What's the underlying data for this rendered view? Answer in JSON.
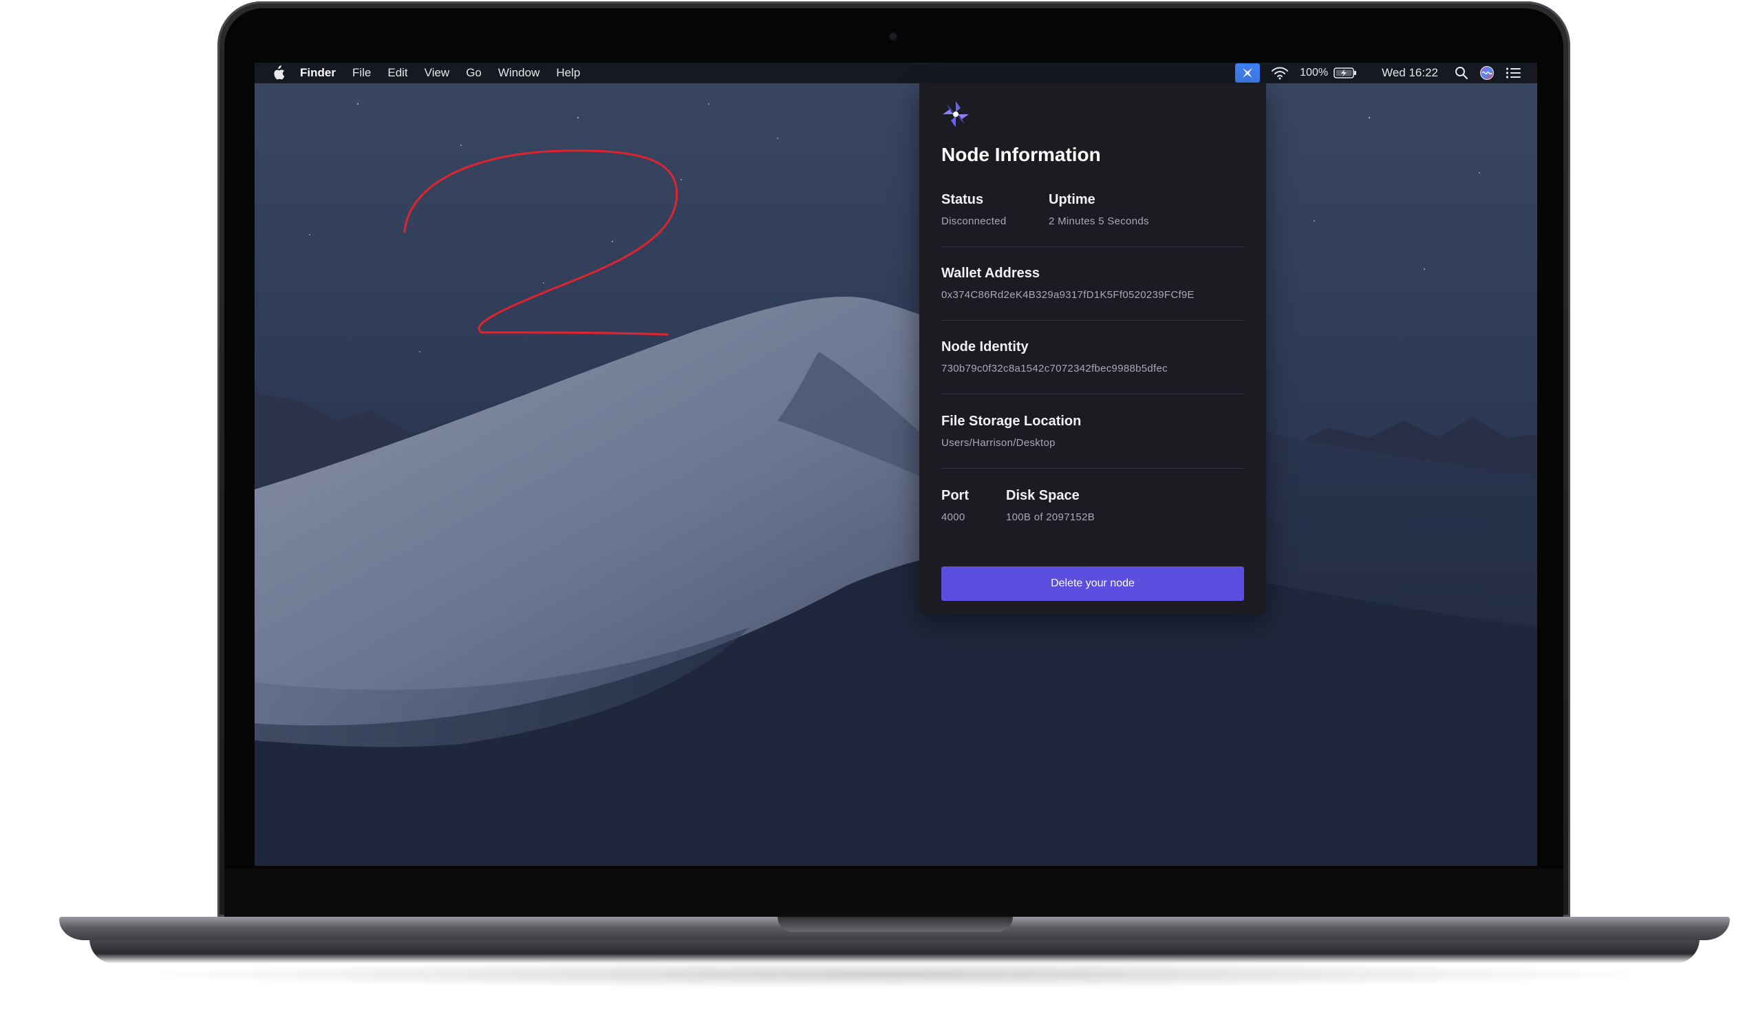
{
  "menubar": {
    "app_name": "Finder",
    "menus": [
      "File",
      "Edit",
      "View",
      "Go",
      "Window",
      "Help"
    ],
    "battery_percent": "100%",
    "clock": "Wed 16:22"
  },
  "popover": {
    "title": "Node Information",
    "status": {
      "label": "Status",
      "value": "Disconnected"
    },
    "uptime": {
      "label": "Uptime",
      "value": "2 Minutes 5 Seconds"
    },
    "wallet": {
      "label": "Wallet Address",
      "value": "0x374C86Rd2eK4B329a9317fD1K5Ff0520239FCf9E"
    },
    "identity": {
      "label": "Node Identity",
      "value": "730b79c0f32c8a1542c7072342fbec9988b5dfec"
    },
    "storage": {
      "label": "File Storage Location",
      "value": "Users/Harrison/Desktop"
    },
    "port": {
      "label": "Port",
      "value": "4000"
    },
    "disk": {
      "label": "Disk Space",
      "value": "100B of 2097152B"
    },
    "delete_button": "Delete your node"
  },
  "colors": {
    "accent": "#5b4fe0",
    "tray_highlight": "#3f7ef0",
    "popover_bg": "#1b1b21",
    "annotation_red": "#e0232e"
  },
  "icons": [
    "apple-icon",
    "app-logo-icon",
    "wifi-icon",
    "battery-icon",
    "search-icon",
    "siri-icon",
    "notification-center-icon"
  ]
}
